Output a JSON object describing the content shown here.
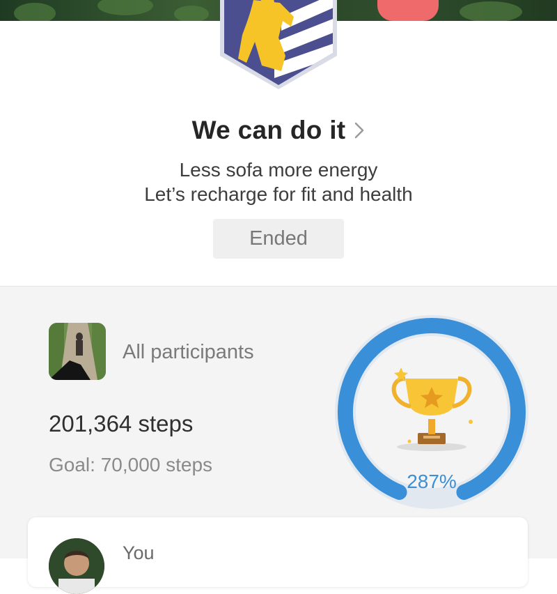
{
  "header": {
    "badge_icon": "runner-shield-badge"
  },
  "challenge": {
    "title": "We can do it",
    "title_icon": "chevron-right-icon",
    "description_line1": "Less sofa more energy",
    "description_line2": "Let’s recharge for fit and health",
    "status_label": "Ended"
  },
  "stats": {
    "participants_label": "All participants",
    "steps_value": "201,364 steps",
    "goal_text": "Goal: 70,000 steps",
    "progress_percent_label": "287%",
    "progress_fraction": 2.87,
    "trophy_icon": "trophy-icon",
    "ring_color": "#3a8fd9"
  },
  "you_card": {
    "label": "You"
  }
}
